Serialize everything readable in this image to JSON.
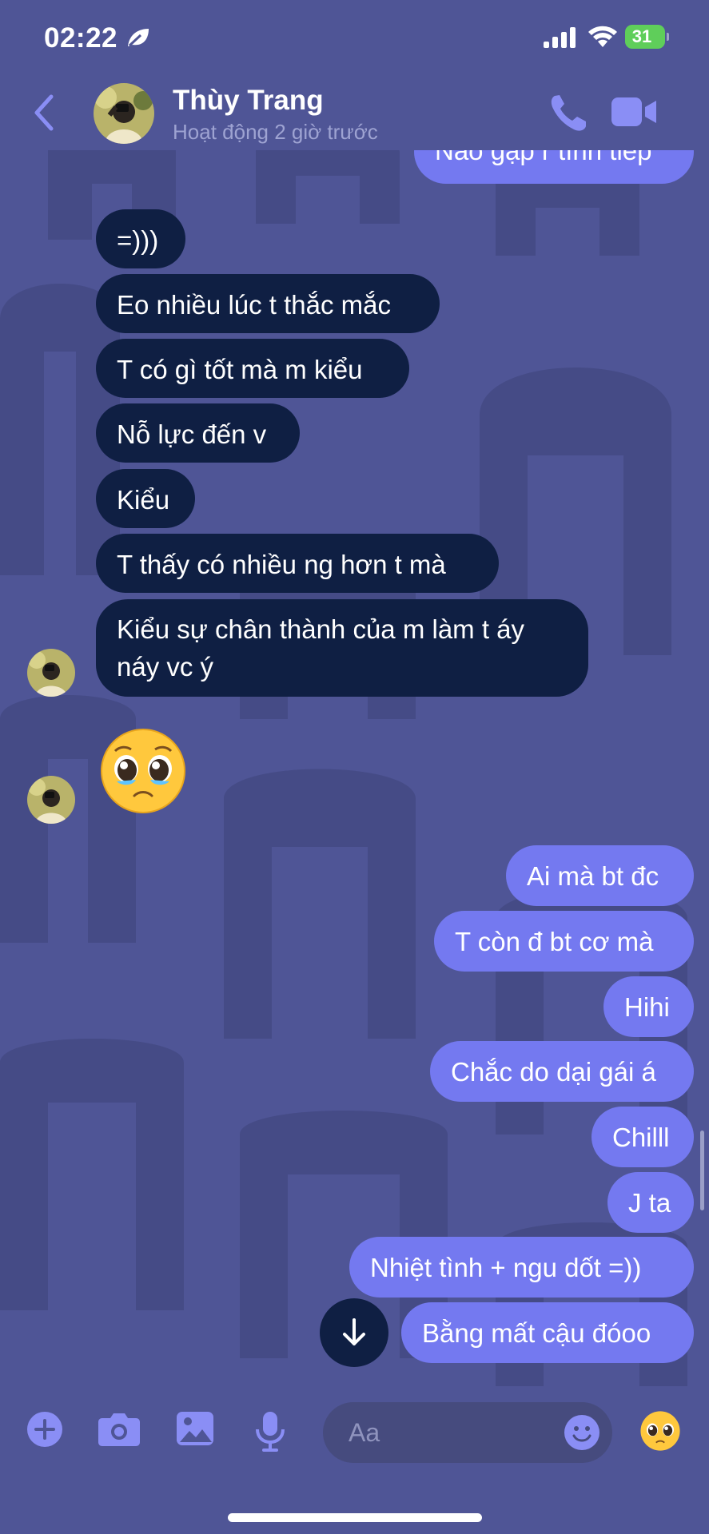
{
  "status_bar": {
    "time": "02:22",
    "battery": "31"
  },
  "header": {
    "name": "Thùy Trang",
    "activity": "Hoạt động 2 giờ trước"
  },
  "messages": {
    "partial_top": "Nào gặp r tính tiếp",
    "incoming": [
      "=)))",
      "Eo nhiều lúc t thắc mắc",
      "T có gì tốt mà m kiểu",
      "Nỗ lực đến v",
      "Kiểu",
      "T thấy có nhiều ng hơn t mà",
      "Kiểu sự chân thành của m làm t áy",
      "náy vc ý"
    ],
    "outgoing": [
      "Ai mà bt đc",
      "T còn đ bt cơ mà",
      "Hihi",
      "Chắc do dại gái á",
      "Chilll",
      "J ta",
      "Nhiệt tình + ngu dốt =))",
      "Bằng mất cậu đóoo"
    ]
  },
  "composer": {
    "placeholder": "Aa"
  },
  "icons": [
    "leaf-icon",
    "signal-icon",
    "wifi-icon",
    "battery-icon",
    "back-chevron-icon",
    "phone-icon",
    "video-camera-icon",
    "pleading-face-emoji",
    "arrow-down-icon",
    "plus-icon",
    "camera-icon",
    "image-icon",
    "microphone-icon",
    "smiley-icon"
  ],
  "colors": {
    "background": "#4f5596",
    "incoming_bubble": "#0f1f43",
    "outgoing_bubble": "#7479f0",
    "accent": "#8a8ef5"
  }
}
